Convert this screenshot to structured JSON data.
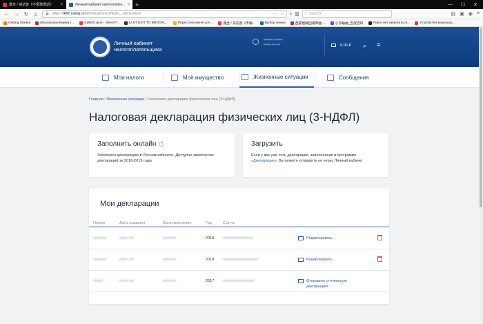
{
  "browser": {
    "tabs": [
      {
        "title": "露全 / 孫訪善《不傷弛恨訪》",
        "active": false,
        "fav_color": "#e53935"
      },
      {
        "title": "Личный кабинет налогоплате...",
        "active": true,
        "fav_color": "#2a5ca8"
      }
    ],
    "new_tab": "+",
    "url_scheme": "https://",
    "url_host": "lkfl2.nalog.ru",
    "url_path": "/lkfl/situations/3NDFL_declaration",
    "search_placeholder": "Search",
    "bookmarks": [
      {
        "label": "Getting Started",
        "color": "#ff7a00"
      },
      {
        "label": "Московская Биржа | ...",
        "color": "#c62828"
      },
      {
        "label": "Called Upon - Silent P...",
        "color": "#e53935"
      },
      {
        "label": "LAST EXIT TO BROOKL...",
        "color": "#333"
      },
      {
        "label": "Перестали меняться ...",
        "color": "#f4b400"
      },
      {
        "label": "露全 / 孫訪善《不傷...",
        "color": "#e53935"
      },
      {
        "label": "Выбор сюжки",
        "color": "#1565c0"
      },
      {
        "label": "西部厘戦回葛神曲 ...",
        "color": "#c62828"
      },
      {
        "label": "小丹岫岫_百度百科",
        "color": "#2e63d6"
      },
      {
        "label": "Перестал запускаться...",
        "color": "#222"
      },
      {
        "label": "Устройство видеокар...",
        "color": "#e53935"
      }
    ]
  },
  "header": {
    "brand_line1": "Личный кабинет",
    "brand_line2": "налогоплательщика",
    "user_line1": "•••••••• •••••••",
    "user_line2": "•••••• ••• •••",
    "balance": "0.00 ₽"
  },
  "nav": {
    "items": [
      {
        "label": "Мои налоги"
      },
      {
        "label": "Моё имущество"
      },
      {
        "label": "Жизненные ситуации"
      },
      {
        "label": "Сообщения"
      }
    ]
  },
  "breadcrumb": {
    "home": "Главная",
    "section": "Жизненные ситуации",
    "current": "Налоговая декларация физических лиц (3-НДФЛ)",
    "sep": "/"
  },
  "page_title": "Налоговая декларация физических лиц (3-НДФЛ)",
  "card_fill": {
    "title": "Заполнить онлайн",
    "help": "?",
    "text": "Заполните декларацию в Личном кабинете. Доступно заполнение деклараций за 2016-2019 годы"
  },
  "card_upload": {
    "title": "Загрузить",
    "text_before": "Если у вас уже есть декларация, заполненная в программе ",
    "link": "«Декларация»",
    "text_after": ", Вы можете отправить ее через Личный кабинет"
  },
  "declarations": {
    "title": "Мои декларации",
    "columns": [
      "Номер",
      "Дата создания",
      "Дата изменения",
      "Год",
      "Статус"
    ],
    "rows": [
      {
        "number": "••••••••",
        "created": "••••• •••",
        "changed": "••••••••",
        "year": "2018",
        "status": "••••••••••••••••••",
        "action": "Редактировать",
        "deletable": true
      },
      {
        "number": "••••••••",
        "created": "••••• •••",
        "changed": "••••••••",
        "year": "2018",
        "status": "•••••••••••••••••••••",
        "action": "Редактировать",
        "deletable": true
      },
      {
        "number": "••••••",
        "created": "••••• •••",
        "changed": "••••••••",
        "year": "2017",
        "status": "•••••••••••••••••••",
        "action": "Отправить уточненную декларацию",
        "deletable": false
      }
    ]
  }
}
